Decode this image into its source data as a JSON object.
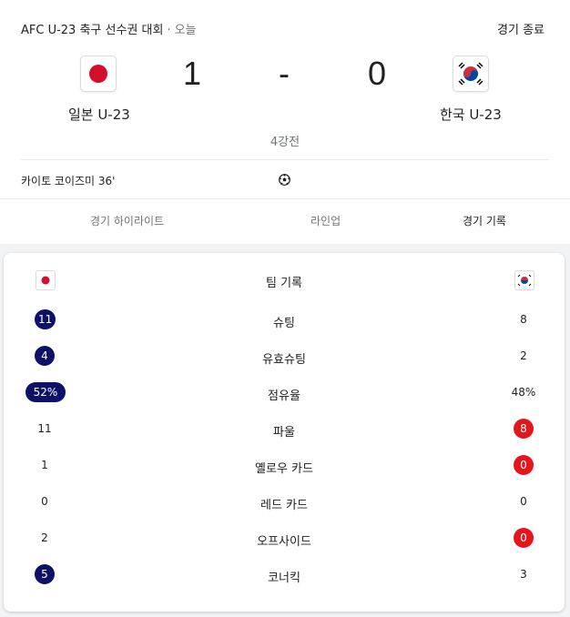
{
  "header": {
    "competition": "AFC U-23 축구 선수권 대회",
    "separator": "·",
    "date": "오늘",
    "status": "경기 종료"
  },
  "match": {
    "home": {
      "name": "일본 U-23",
      "score": "1",
      "flag": "japan-flag"
    },
    "away": {
      "name": "한국 U-23",
      "score": "0",
      "flag": "korea-flag"
    },
    "score_dash": "-",
    "round": "4강전",
    "scorers": [
      {
        "text": "카이토 코이즈미 36'",
        "icon": "soccer-ball-icon"
      }
    ]
  },
  "tabs": [
    {
      "label": "경기 하이라이트",
      "active": false
    },
    {
      "label": "라인업",
      "active": false
    },
    {
      "label": "경기 기록",
      "active": true
    }
  ],
  "stats": {
    "title": "팀 기록",
    "rows": [
      {
        "label": "슈팅",
        "home": "11",
        "away": "8",
        "home_highlight": true,
        "away_highlight": false
      },
      {
        "label": "유효슈팅",
        "home": "4",
        "away": "2",
        "home_highlight": true,
        "away_highlight": false
      },
      {
        "label": "점유율",
        "home": "52%",
        "away": "48%",
        "home_highlight": true,
        "away_highlight": false
      },
      {
        "label": "파울",
        "home": "11",
        "away": "8",
        "home_highlight": false,
        "away_highlight": true
      },
      {
        "label": "옐로우 카드",
        "home": "1",
        "away": "0",
        "home_highlight": false,
        "away_highlight": true
      },
      {
        "label": "레드 카드",
        "home": "0",
        "away": "0",
        "home_highlight": false,
        "away_highlight": false
      },
      {
        "label": "오프사이드",
        "home": "2",
        "away": "0",
        "home_highlight": false,
        "away_highlight": true
      },
      {
        "label": "코너킥",
        "home": "5",
        "away": "3",
        "home_highlight": true,
        "away_highlight": false
      }
    ]
  },
  "colors": {
    "home_accent": "#0d1169",
    "away_accent": "#e3161c"
  }
}
